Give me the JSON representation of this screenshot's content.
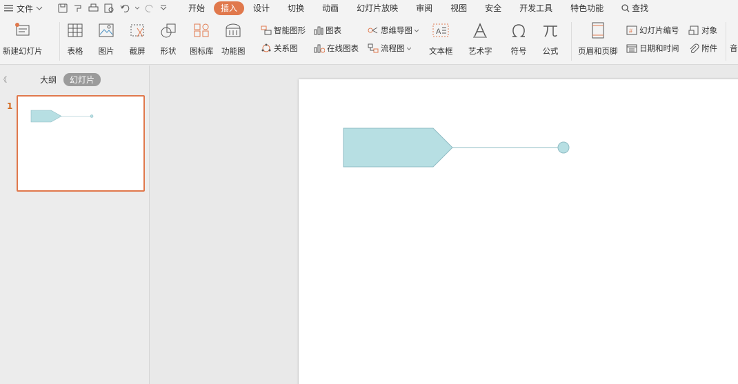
{
  "menu": {
    "file_label": "文件",
    "tabs": [
      "开始",
      "插入",
      "设计",
      "切换",
      "动画",
      "幻灯片放映",
      "审阅",
      "视图",
      "安全",
      "开发工具",
      "特色功能"
    ],
    "active_tab": "插入",
    "search_label": "查找"
  },
  "ribbon": {
    "new_slide": "新建幻灯片",
    "table": "表格",
    "picture": "图片",
    "screenshot": "截屏",
    "shape": "形状",
    "icon_lib": "图标库",
    "func_chart": "功能图",
    "smart_art": "智能图形",
    "chart": "图表",
    "mind_map": "思维导图",
    "relation": "关系图",
    "online_chart": "在线图表",
    "flowchart": "流程图",
    "textbox": "文本框",
    "art_text": "艺术字",
    "symbol": "符号",
    "formula": "公式",
    "header_footer": "页眉和页脚",
    "slide_number": "幻灯片编号",
    "object": "对象",
    "date_time": "日期和时间",
    "attachment": "附件",
    "more": "音"
  },
  "panel": {
    "outline_tab": "大纲",
    "slides_tab": "幻灯片",
    "collapse_symbol": "《",
    "slide_index": "1"
  },
  "colors": {
    "accent": "#e0784c",
    "shape_fill": "#b7dfe3",
    "shape_stroke": "#8fbcc4"
  }
}
